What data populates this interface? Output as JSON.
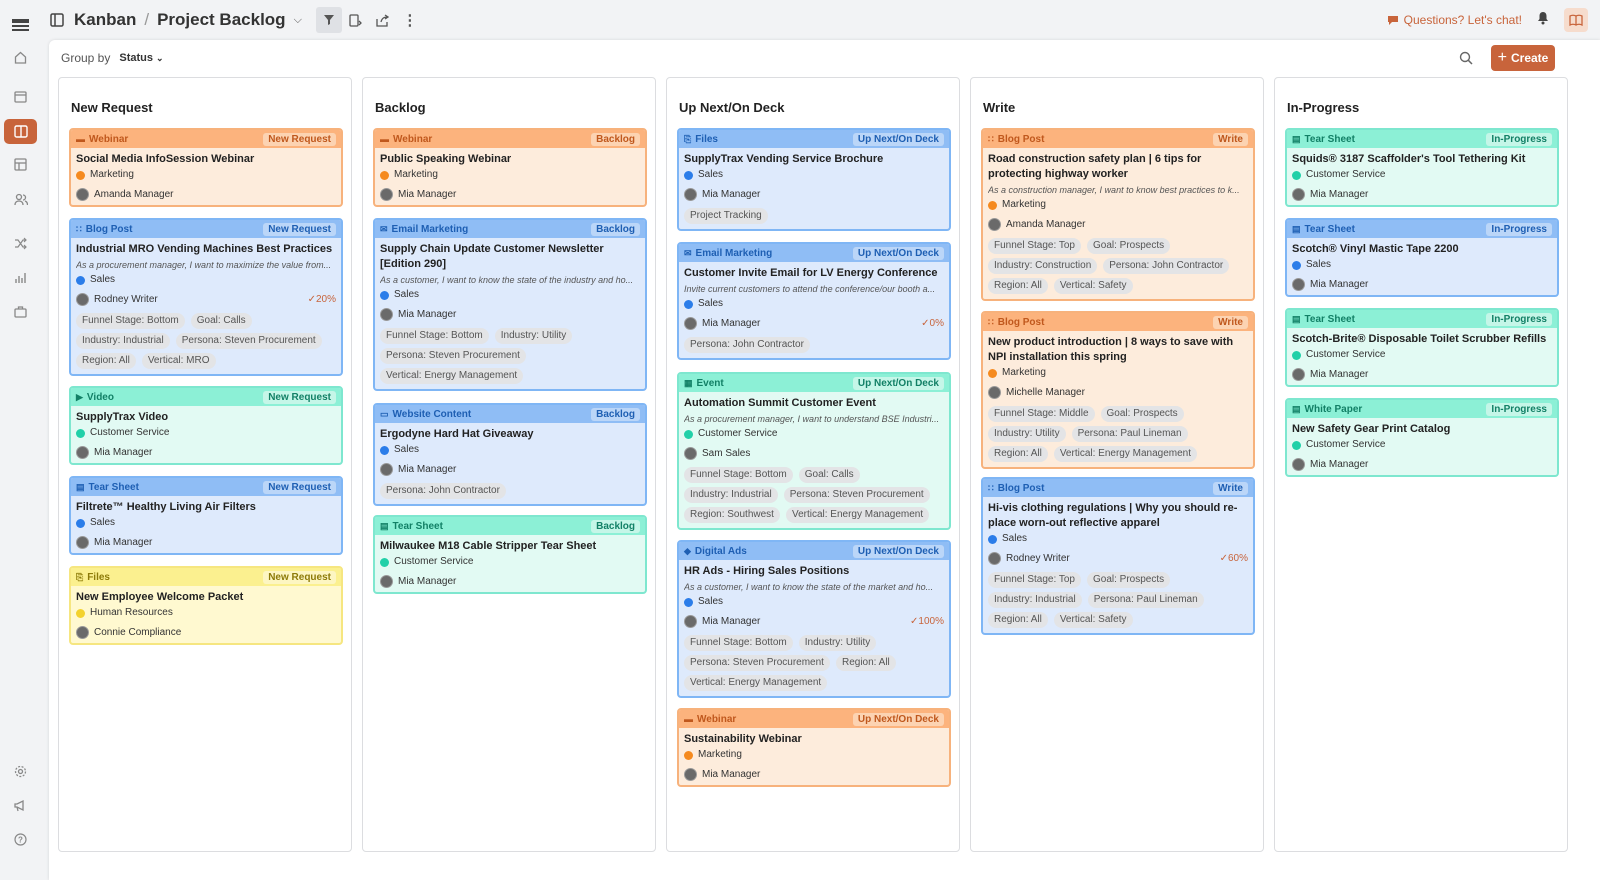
{
  "topbar": {
    "board": "Kanban",
    "project": "Project Backlog",
    "chat": "Questions? Let's chat!"
  },
  "toolbar": {
    "group_by_label": "Group by",
    "group_by_value": "Status",
    "create_label": "Create"
  },
  "colors": {
    "accent": "#c8643b",
    "orange": "#fcb37d",
    "blue": "#8fbdf5",
    "green": "#8cf0d6",
    "yellow": "#fbf08f"
  },
  "columns": [
    {
      "title": "New Request",
      "cards": [
        {
          "type": "Webinar",
          "status": "New Request",
          "title": "Social Media InfoSession Webinar",
          "dept": "Marketing",
          "assignee": "Amanda Manager"
        },
        {
          "type": "Blog Post",
          "status": "New Request",
          "title": "Industrial MRO Vending Machines Best Practices",
          "desc": "As a procurement manager, I want to maximize the value from...",
          "dept": "Sales",
          "assignee": "Rodney Writer",
          "progress": "20%",
          "tags": [
            "Funnel Stage: Bottom",
            "Goal: Calls",
            "Industry: Industrial",
            "Persona: Steven Procurement",
            "Region: All",
            "Vertical: MRO"
          ]
        },
        {
          "type": "Video",
          "status": "New Request",
          "title": "SupplyTrax Video",
          "dept": "Customer Service",
          "assignee": "Mia Manager"
        },
        {
          "type": "Tear Sheet",
          "status": "New Request",
          "title": "Filtrete™ Healthy Living Air Filters",
          "dept": "Sales",
          "assignee": "Mia Manager"
        },
        {
          "type": "Files",
          "status": "New Request",
          "title": "New Employee Welcome Packet",
          "dept": "Human Resources",
          "assignee": "Connie Compliance"
        }
      ]
    },
    {
      "title": "Backlog",
      "cards": [
        {
          "type": "Webinar",
          "status": "Backlog",
          "title": "Public Speaking Webinar",
          "dept": "Marketing",
          "assignee": "Mia Manager"
        },
        {
          "type": "Email Marketing",
          "status": "Backlog",
          "title": "Supply Chain Update Customer Newsletter [Edition 290]",
          "desc": "As a customer, I want to know the state of the industry and ho...",
          "dept": "Sales",
          "assignee": "Mia Manager",
          "tags": [
            "Funnel Stage: Bottom",
            "Industry: Utility",
            "Persona: Steven Procurement",
            "Vertical: Energy Management"
          ]
        },
        {
          "type": "Website Content",
          "status": "Backlog",
          "title": "Ergodyne Hard Hat Giveaway",
          "dept": "Sales",
          "assignee": "Mia Manager",
          "tags": [
            "Persona: John Contractor"
          ]
        },
        {
          "type": "Tear Sheet",
          "status": "Backlog",
          "title": "Milwaukee M18 Cable Stripper Tear Sheet",
          "dept": "Customer Service",
          "assignee": "Mia Manager"
        }
      ]
    },
    {
      "title": "Up Next/On Deck",
      "cards": [
        {
          "type": "Files",
          "status": "Up Next/On Deck",
          "title": "SupplyTrax Vending Service Brochure",
          "dept": "Sales",
          "assignee": "Mia Manager",
          "tags": [
            "Project Tracking"
          ]
        },
        {
          "type": "Email Marketing",
          "status": "Up Next/On Deck",
          "title": "Customer Invite Email for LV Energy Conference",
          "desc": "Invite current customers to attend the conference/our booth a...",
          "dept": "Sales",
          "assignee": "Mia Manager",
          "progress": "0%",
          "tags": [
            "Persona: John Contractor"
          ]
        },
        {
          "type": "Event",
          "status": "Up Next/On Deck",
          "title": "Automation Summit Customer Event",
          "desc": "As a procurement manager, I want to understand BSE Industri...",
          "dept": "Customer Service",
          "assignee": "Sam Sales",
          "tags": [
            "Funnel Stage: Bottom",
            "Goal: Calls",
            "Industry: Industrial",
            "Persona: Steven Procurement",
            "Region: Southwest",
            "Vertical: Energy Management"
          ]
        },
        {
          "type": "Digital Ads",
          "status": "Up Next/On Deck",
          "title": "HR Ads - Hiring Sales Positions",
          "desc": "As a customer, I want to know the state of the market and ho...",
          "dept": "Sales",
          "assignee": "Mia Manager",
          "progress": "100%",
          "tags": [
            "Funnel Stage: Bottom",
            "Industry: Utility",
            "Persona: Steven Procurement",
            "Region: All",
            "Vertical: Energy Management"
          ]
        },
        {
          "type": "Webinar",
          "status": "Up Next/On Deck",
          "title": "Sustainability Webinar",
          "dept": "Marketing",
          "assignee": "Mia Manager"
        }
      ]
    },
    {
      "title": "Write",
      "cards": [
        {
          "type": "Blog Post",
          "status": "Write",
          "title": "Road construction safety plan | 6 tips for protecting highway worker",
          "desc": "As a construction manager, I want to know best practices to k...",
          "dept": "Marketing",
          "assignee": "Amanda Manager",
          "tags": [
            "Funnel Stage: Top",
            "Goal: Prospects",
            "Industry: Construction",
            "Persona: John Contractor",
            "Region: All",
            "Vertical: Safety"
          ]
        },
        {
          "type": "Blog Post",
          "status": "Write",
          "title": "New product introduction | 8 ways to save with NPI installation this spring",
          "dept": "Marketing",
          "assignee": "Michelle Manager",
          "tags": [
            "Funnel Stage: Middle",
            "Goal: Prospects",
            "Industry: Utility",
            "Persona: Paul Lineman",
            "Region: All",
            "Vertical: Energy Management"
          ]
        },
        {
          "type": "Blog Post",
          "status": "Write",
          "title": "Hi-vis clothing regulations | Why you should re-place worn-out reflective apparel",
          "dept": "Sales",
          "assignee": "Rodney Writer",
          "progress": "60%",
          "tags": [
            "Funnel Stage: Top",
            "Goal: Prospects",
            "Industry: Industrial",
            "Persona: Paul Lineman",
            "Region: All",
            "Vertical: Safety"
          ]
        }
      ]
    },
    {
      "title": "In-Progress",
      "cards": [
        {
          "type": "Tear Sheet",
          "status": "In-Progress",
          "title": "Squids® 3187 Scaffolder's Tool Tethering Kit",
          "dept": "Customer Service",
          "assignee": "Mia Manager"
        },
        {
          "type": "Tear Sheet",
          "status": "In-Progress",
          "title": "Scotch® Vinyl Mastic Tape 2200",
          "dept": "Sales",
          "assignee": "Mia Manager"
        },
        {
          "type": "Tear Sheet",
          "status": "In-Progress",
          "title": "Scotch-Brite® Disposable Toilet Scrubber Refills",
          "dept": "Customer Service",
          "assignee": "Mia Manager"
        },
        {
          "type": "White Paper",
          "status": "In-Progress",
          "title": "New Safety Gear Print Catalog",
          "dept": "Customer Service",
          "assignee": "Mia Manager"
        }
      ]
    }
  ]
}
